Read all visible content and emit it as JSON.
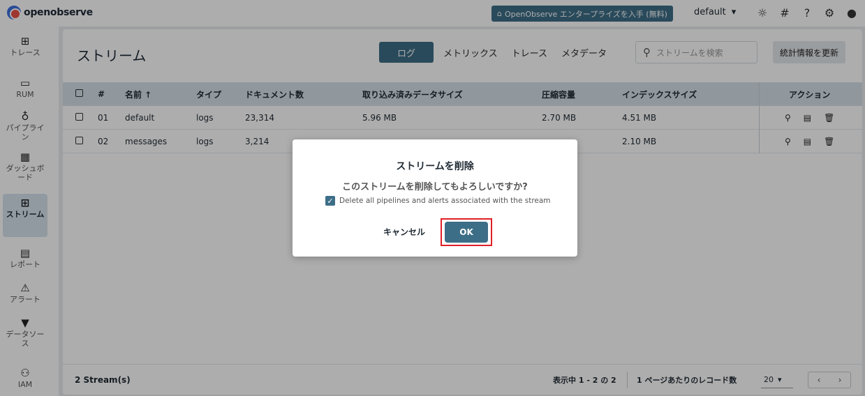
{
  "header": {
    "logo_text": "openobserve",
    "enterprise_label": "OpenObserve エンタープライズを入手 (無料)",
    "org": "default",
    "icons": [
      "theme-icon",
      "slack-icon",
      "help-icon",
      "settings-icon",
      "user-icon"
    ]
  },
  "sidebar": {
    "items": [
      {
        "label": "トレース",
        "icon": "traces-icon"
      },
      {
        "label": "RUM",
        "icon": "rum-icon"
      },
      {
        "label": "パイプライン",
        "icon": "pipeline-icon"
      },
      {
        "label": "ダッシュボード",
        "icon": "dashboard-icon"
      },
      {
        "label": "ストリーム",
        "icon": "streams-icon",
        "active": true
      },
      {
        "label": "レポート",
        "icon": "report-icon"
      },
      {
        "label": "アラート",
        "icon": "alert-icon"
      },
      {
        "label": "データソース",
        "icon": "datasource-icon"
      },
      {
        "label": "IAM",
        "icon": "iam-icon"
      }
    ]
  },
  "page": {
    "title": "ストリーム",
    "tabs": [
      "ログ",
      "メトリックス",
      "トレース",
      "メタデータ"
    ],
    "search_placeholder": "ストリームを検索",
    "refresh_label": "統計情報を更新"
  },
  "table": {
    "headers": [
      "#",
      "名前 ↑",
      "タイプ",
      "ドキュメント数",
      "取り込み済みデータサイズ",
      "圧縮容量",
      "インデックスサイズ",
      "アクション"
    ],
    "rows": [
      {
        "num": "01",
        "name": "default",
        "type": "logs",
        "docs": "23,314",
        "ingested": "5.96 MB",
        "compressed": "2.70 MB",
        "index": "4.51 MB"
      },
      {
        "num": "02",
        "name": "messages",
        "type": "logs",
        "docs": "3,214",
        "ingested": "",
        "compressed": "",
        "index": "2.10 MB"
      }
    ]
  },
  "footer": {
    "count": "2 Stream(s)",
    "range": "表示中 1 - 2 の 2",
    "per_page_label": "1 ページあたりのレコード数",
    "per_page_value": "20"
  },
  "dialog": {
    "title": "ストリームを削除",
    "message": "このストリームを削除してもよろしいですか?",
    "checkbox_label": "Delete all pipelines and alerts associated with the stream",
    "checkbox_checked": true,
    "cancel_label": "キャンセル",
    "ok_label": "OK"
  },
  "colors": {
    "accent": "#3d6e87",
    "highlight_frame": "#e01f26"
  }
}
